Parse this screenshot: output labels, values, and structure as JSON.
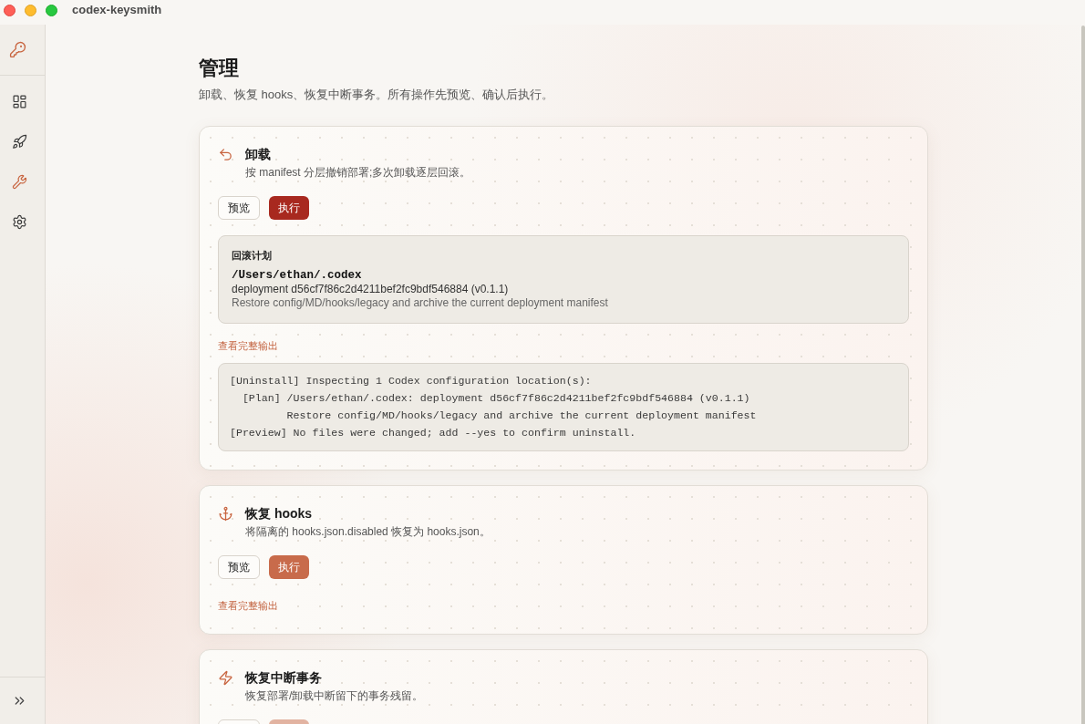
{
  "window": {
    "title": "codex-keysmith"
  },
  "sidebar": {
    "nav": [
      {
        "selected": false
      },
      {
        "selected": false
      },
      {
        "selected": true
      },
      {
        "selected": false
      }
    ]
  },
  "page": {
    "title": "管理",
    "subtitle": "卸载、恢复 hooks、恢复中断事务。所有操作先预览、确认后执行。"
  },
  "sections": [
    {
      "title": "卸载",
      "description": "按 manifest 分层撤销部署;多次卸载逐层回滚。",
      "buttons": [
        {
          "label": "预览",
          "kind": "secondary",
          "disabled": false
        },
        {
          "label": "执行",
          "kind": "danger",
          "disabled": false
        }
      ],
      "plan": {
        "title": "回滚计划",
        "entries": [
          {
            "path": "/Users/ethan/.codex",
            "deployment": "deployment d56cf7f86c2d4211bef2fc9bdf546884 (v0.1.1)",
            "action": "Restore config/MD/hooks/legacy and archive the current deployment manifest"
          }
        ]
      },
      "output_link": "查看完整输出",
      "output": [
        "[Uninstall] Inspecting 1 Codex configuration location(s):",
        "  [Plan] /Users/ethan/.codex: deployment d56cf7f86c2d4211bef2fc9bdf546884 (v0.1.1)",
        "         Restore config/MD/hooks/legacy and archive the current deployment manifest",
        "[Preview] No files were changed; add --yes to confirm uninstall."
      ]
    },
    {
      "title": "恢复 hooks",
      "description": "将隔离的 hooks.json.disabled 恢复为 hooks.json。",
      "buttons": [
        {
          "label": "预览",
          "kind": "secondary",
          "disabled": false
        },
        {
          "label": "执行",
          "kind": "primary",
          "disabled": false
        }
      ],
      "output_link": "查看完整输出"
    },
    {
      "title": "恢复中断事务",
      "description": "恢复部署/卸载中断留下的事务残留。",
      "buttons": [
        {
          "kind": "secondary",
          "disabled": false
        },
        {
          "kind": "primary",
          "disabled": true
        }
      ]
    }
  ]
}
